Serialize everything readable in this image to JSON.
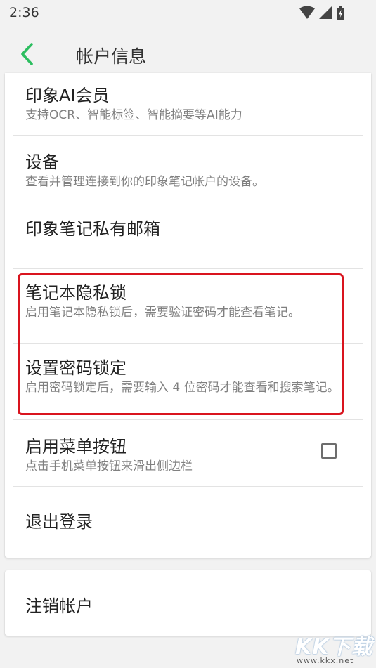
{
  "status_bar": {
    "time": "2:36"
  },
  "header": {
    "title": "帐户信息"
  },
  "settings": [
    {
      "title": "印象AI会员",
      "subtitle": "支持OCR、智能标签、智能摘要等AI能力"
    },
    {
      "title": "设备",
      "subtitle": "查看并管理连接到你的印象笔记帐户的设备。"
    },
    {
      "title": "印象笔记私有邮箱",
      "subtitle": ""
    },
    {
      "title": "笔记本隐私锁",
      "subtitle": "启用笔记本隐私锁后，需要验证密码才能查看笔记。"
    },
    {
      "title": "设置密码锁定",
      "subtitle": "启用密码锁定后，需要输入 4 位密码才能查看和搜索笔记。"
    },
    {
      "title": "启用菜单按钮",
      "subtitle": "点击手机菜单按钮来滑出侧边栏",
      "checked": false
    },
    {
      "title": "退出登录",
      "subtitle": ""
    }
  ],
  "account": {
    "delete_label": "注销帐户"
  },
  "watermark": {
    "logo": "KK下载",
    "url": "www.kkx.net"
  },
  "colors": {
    "accent": "#2dbe60",
    "highlight": "#d9141e"
  }
}
